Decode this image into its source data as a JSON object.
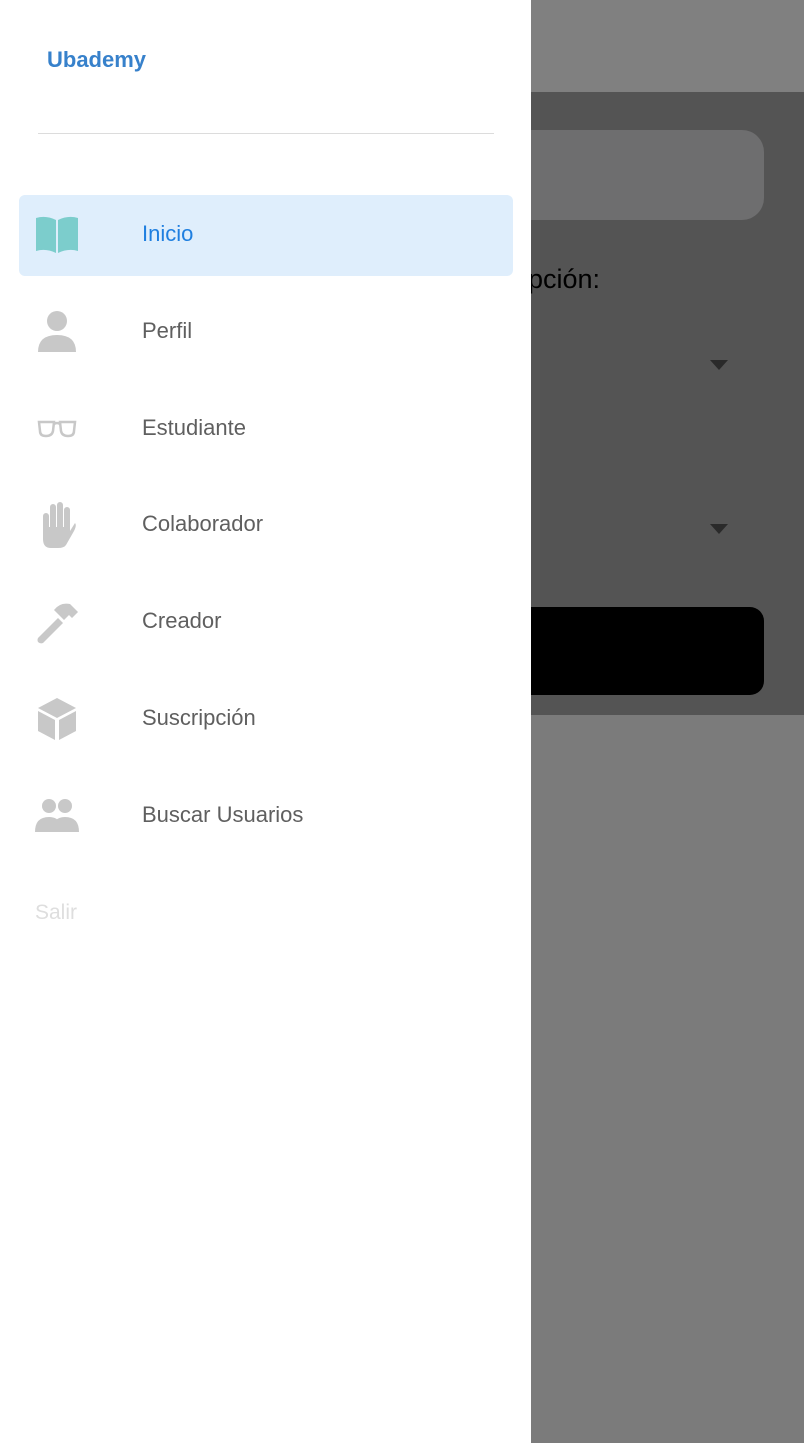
{
  "background_app": {
    "label_partial": "pción:"
  },
  "drawer": {
    "title": "Ubademy",
    "items": [
      {
        "label": "Inicio",
        "icon": "book-open-icon",
        "active": true
      },
      {
        "label": "Perfil",
        "icon": "person-icon",
        "active": false
      },
      {
        "label": "Estudiante",
        "icon": "glasses-icon",
        "active": false
      },
      {
        "label": "Colaborador",
        "icon": "hand-icon",
        "active": false
      },
      {
        "label": "Creador",
        "icon": "hammer-icon",
        "active": false
      },
      {
        "label": "Suscripción",
        "icon": "cube-icon",
        "active": false
      },
      {
        "label": "Buscar Usuarios",
        "icon": "users-icon",
        "active": false
      }
    ],
    "logout_label": "Salir"
  },
  "colors": {
    "accent": "#1f7fe0",
    "title": "#3781cb",
    "active_bg": "#dfeefc",
    "book_icon": "#7ccdcc",
    "inactive_icon": "#c8c8c8"
  }
}
